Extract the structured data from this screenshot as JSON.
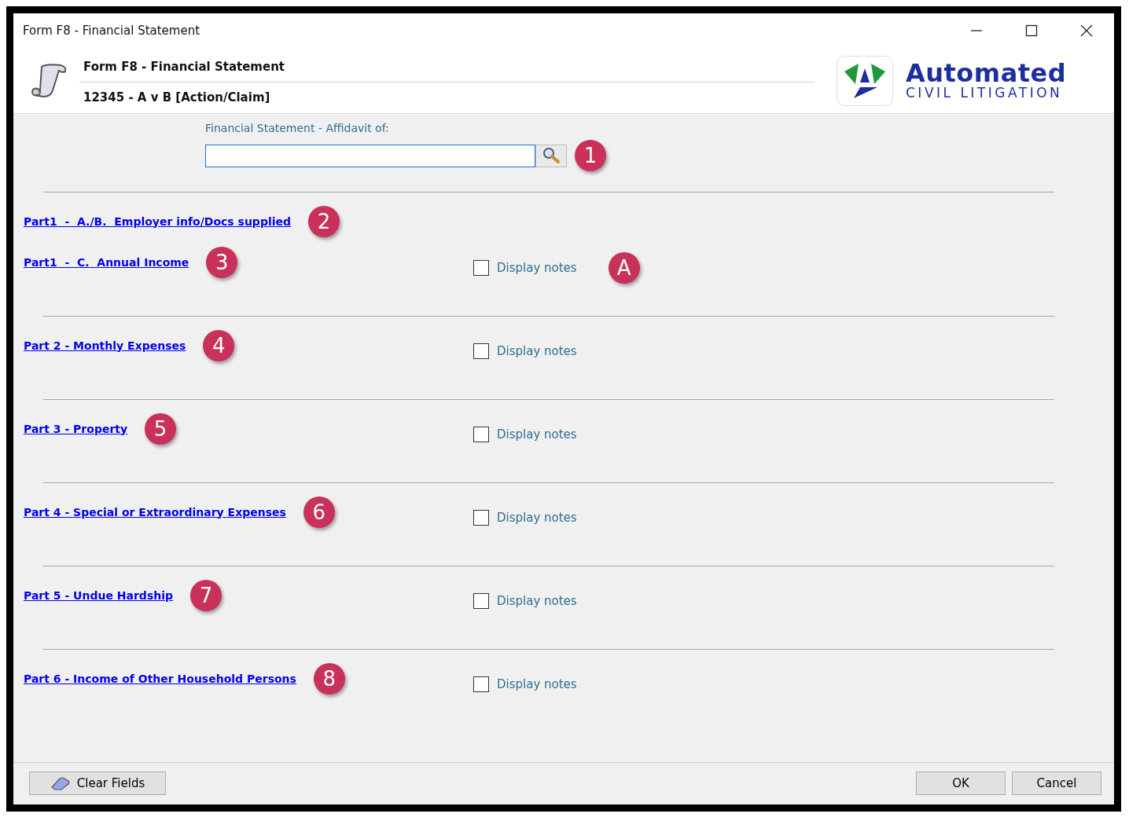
{
  "window": {
    "title": "Form F8 - Financial Statement"
  },
  "header": {
    "title": "Form F8 - Financial Statement",
    "subtitle": "12345 - A v B [Action/Claim]",
    "logo": {
      "name": "Automated",
      "tagline": "CIVIL LITIGATION"
    }
  },
  "affidavit": {
    "label": "Financial Statement - Affidavit of:",
    "marker": "1"
  },
  "groups": [
    {
      "rows": [
        {
          "link": "Part1  -  A./B.  Employer info/Docs supplied",
          "marker": "2"
        },
        {
          "link": "Part1  -  C.  Annual Income",
          "marker": "3",
          "notes": {
            "label": "Display notes",
            "checked": false
          },
          "notes_marker": "A"
        }
      ]
    },
    {
      "rows": [
        {
          "link": "Part 2 - Monthly Expenses",
          "marker": "4",
          "notes": {
            "label": "Display notes",
            "checked": false
          }
        }
      ]
    },
    {
      "rows": [
        {
          "link": "Part 3 - Property",
          "marker": "5",
          "notes": {
            "label": "Display notes",
            "checked": false
          }
        }
      ]
    },
    {
      "rows": [
        {
          "link": "Part 4 - Special or Extraordinary Expenses",
          "marker": "6",
          "notes": {
            "label": "Display notes",
            "checked": false
          }
        }
      ]
    },
    {
      "rows": [
        {
          "link": "Part 5 - Undue Hardship",
          "marker": "7",
          "notes": {
            "label": "Display notes",
            "checked": false
          }
        }
      ]
    },
    {
      "rows": [
        {
          "link": "Part 6 - Income of Other Household Persons",
          "marker": "8",
          "notes": {
            "label": "Display notes",
            "checked": false
          }
        }
      ]
    }
  ],
  "footer": {
    "clear": "Clear Fields",
    "ok": "OK",
    "cancel": "Cancel"
  }
}
